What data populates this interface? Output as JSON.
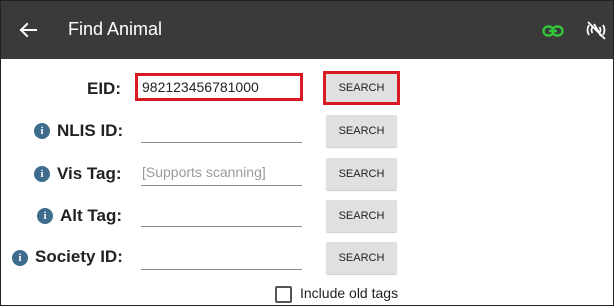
{
  "header": {
    "title": "Find Animal",
    "back_icon": "arrow-left-icon",
    "link_icon": "link-icon",
    "link_icon_color": "#33c43a",
    "nfc_icon": "nfc-off-icon"
  },
  "fields": {
    "eid": {
      "label": "EID:",
      "value": "982123456781000",
      "button": "SEARCH",
      "highlight_color": "#d81b23"
    },
    "nlis": {
      "label": "NLIS ID:",
      "value": "",
      "button": "SEARCH",
      "info_icon": "info-icon"
    },
    "vis": {
      "label": "Vis Tag:",
      "value": "",
      "placeholder": "[Supports scanning]",
      "button": "SEARCH",
      "info_icon": "info-icon"
    },
    "alt": {
      "label": "Alt Tag:",
      "value": "",
      "button": "SEARCH",
      "info_icon": "info-icon"
    },
    "society": {
      "label": "Society ID:",
      "value": "",
      "button": "SEARCH",
      "info_icon": "info-icon"
    }
  },
  "options": {
    "include_old_tags": {
      "label": "Include old tags",
      "checked": false
    }
  },
  "colors": {
    "app_bar": "#3a3a3a",
    "info_icon": "#3d6c8c",
    "button_bg": "#e0e0e0"
  }
}
